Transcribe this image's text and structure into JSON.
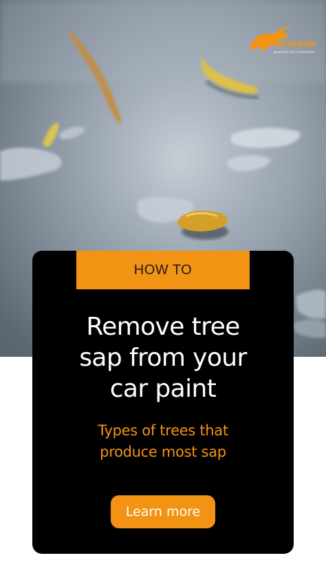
{
  "brand": {
    "logo_name": "FORTADOR",
    "tagline": "powered by Carbreaker",
    "accent_color": "#f39314"
  },
  "hero": {
    "image_description_icon": "bull-logo-icon"
  },
  "card": {
    "badge_label": "HOW TO",
    "headline_lines": [
      "Remove tree",
      "sap from your",
      "car paint"
    ],
    "subhead_lines": [
      "Types of trees that",
      "produce most sap"
    ],
    "cta_label": "Learn more"
  },
  "colors": {
    "card_background": "#000000",
    "accent": "#f39314",
    "headline_text": "#ffffff",
    "page_background": "#ffffff"
  }
}
